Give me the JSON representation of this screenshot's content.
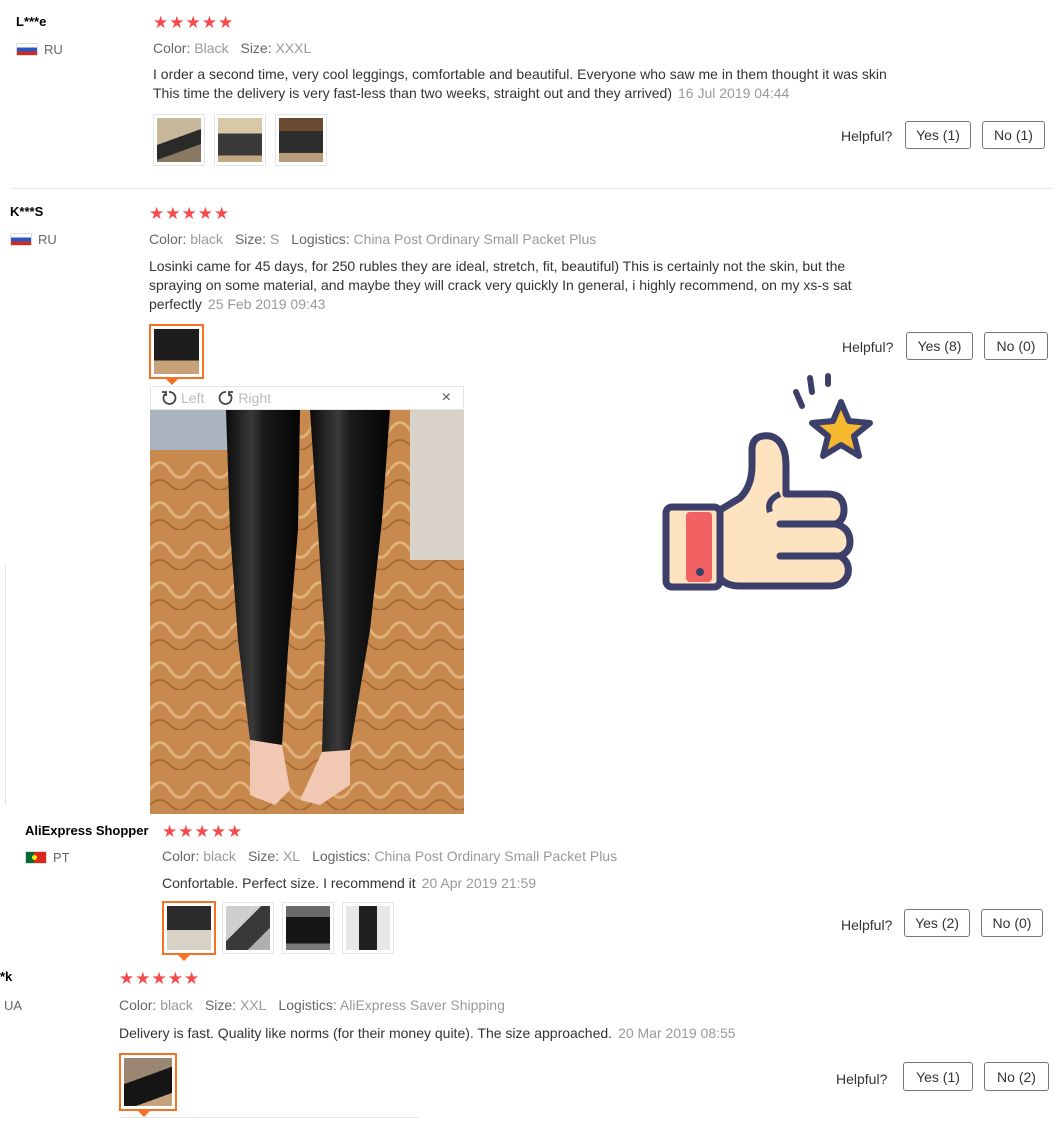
{
  "reviews": [
    {
      "user": "L***e",
      "country": "RU",
      "stars": "★★★★★",
      "color_label": "Color:",
      "color_value": "Black",
      "size_label": "Size:",
      "size_value": "XXXL",
      "text_line1": "I order a second time, very cool leggings, comfortable and beautiful. Everyone who saw me in them thought it was skin",
      "text_line2": "This time the delivery is very fast-less than two weeks, straight out and they arrived)",
      "date": "16 Jul 2019 04:44",
      "helpful_label": "Helpful?",
      "yes_label": "Yes (1)",
      "no_label": "No (1)"
    },
    {
      "user": "K***S",
      "country": "RU",
      "stars": "★★★★★",
      "color_label": "Color:",
      "color_value": "black",
      "size_label": "Size:",
      "size_value": "S",
      "logistics_label": "Logistics:",
      "logistics_value": "China Post Ordinary Small Packet Plus",
      "text_line1": "Losinki came for 45 days, for 250 rubles they are ideal, stretch, fit, beautiful) This is certainly not the skin, but the",
      "text_line2": "spraying on some material, and maybe they will crack very quickly In general, i highly recommend, on my xs-s sat",
      "text_line3": "perfectly",
      "date": "25 Feb 2019 09:43",
      "helpful_label": "Helpful?",
      "yes_label": "Yes (8)",
      "no_label": "No (0)"
    },
    {
      "user": "AliExpress Shopper",
      "country": "PT",
      "stars": "★★★★★",
      "color_label": "Color:",
      "color_value": "black",
      "size_label": "Size:",
      "size_value": "XL",
      "logistics_label": "Logistics:",
      "logistics_value": "China Post Ordinary Small Packet Plus",
      "text_line1": "Confortable. Perfect size. I recommend it",
      "date": "20 Apr 2019 21:59",
      "helpful_label": "Helpful?",
      "yes_label": "Yes (2)",
      "no_label": "No (0)"
    },
    {
      "user": "*k",
      "country": "UA",
      "stars": "★★★★★",
      "color_label": "Color:",
      "color_value": "black",
      "size_label": "Size:",
      "size_value": "XXL",
      "logistics_label": "Logistics:",
      "logistics_value": "AliExpress Saver Shipping",
      "text_line1": "Delivery is fast. Quality like norms (for their money quite). The size approached.",
      "date": "20 Mar 2019 08:55",
      "helpful_label": "Helpful?",
      "yes_label": "Yes (1)",
      "no_label": "No (2)"
    }
  ],
  "viewer": {
    "left_label": "Left",
    "right_label": "Right",
    "close_glyph": "×"
  },
  "colors": {
    "star_red": "#f44c4c",
    "active_orange": "#f57224",
    "thumb_blue": "#3d3f6b",
    "thumb_skin": "#fde3c0",
    "thumb_cuff": "#f26262",
    "star_yellow": "#f5b82e"
  },
  "icons": [
    "rotate-left-icon",
    "rotate-right-icon",
    "close-icon",
    "thumbs-up-icon",
    "star-icon"
  ]
}
